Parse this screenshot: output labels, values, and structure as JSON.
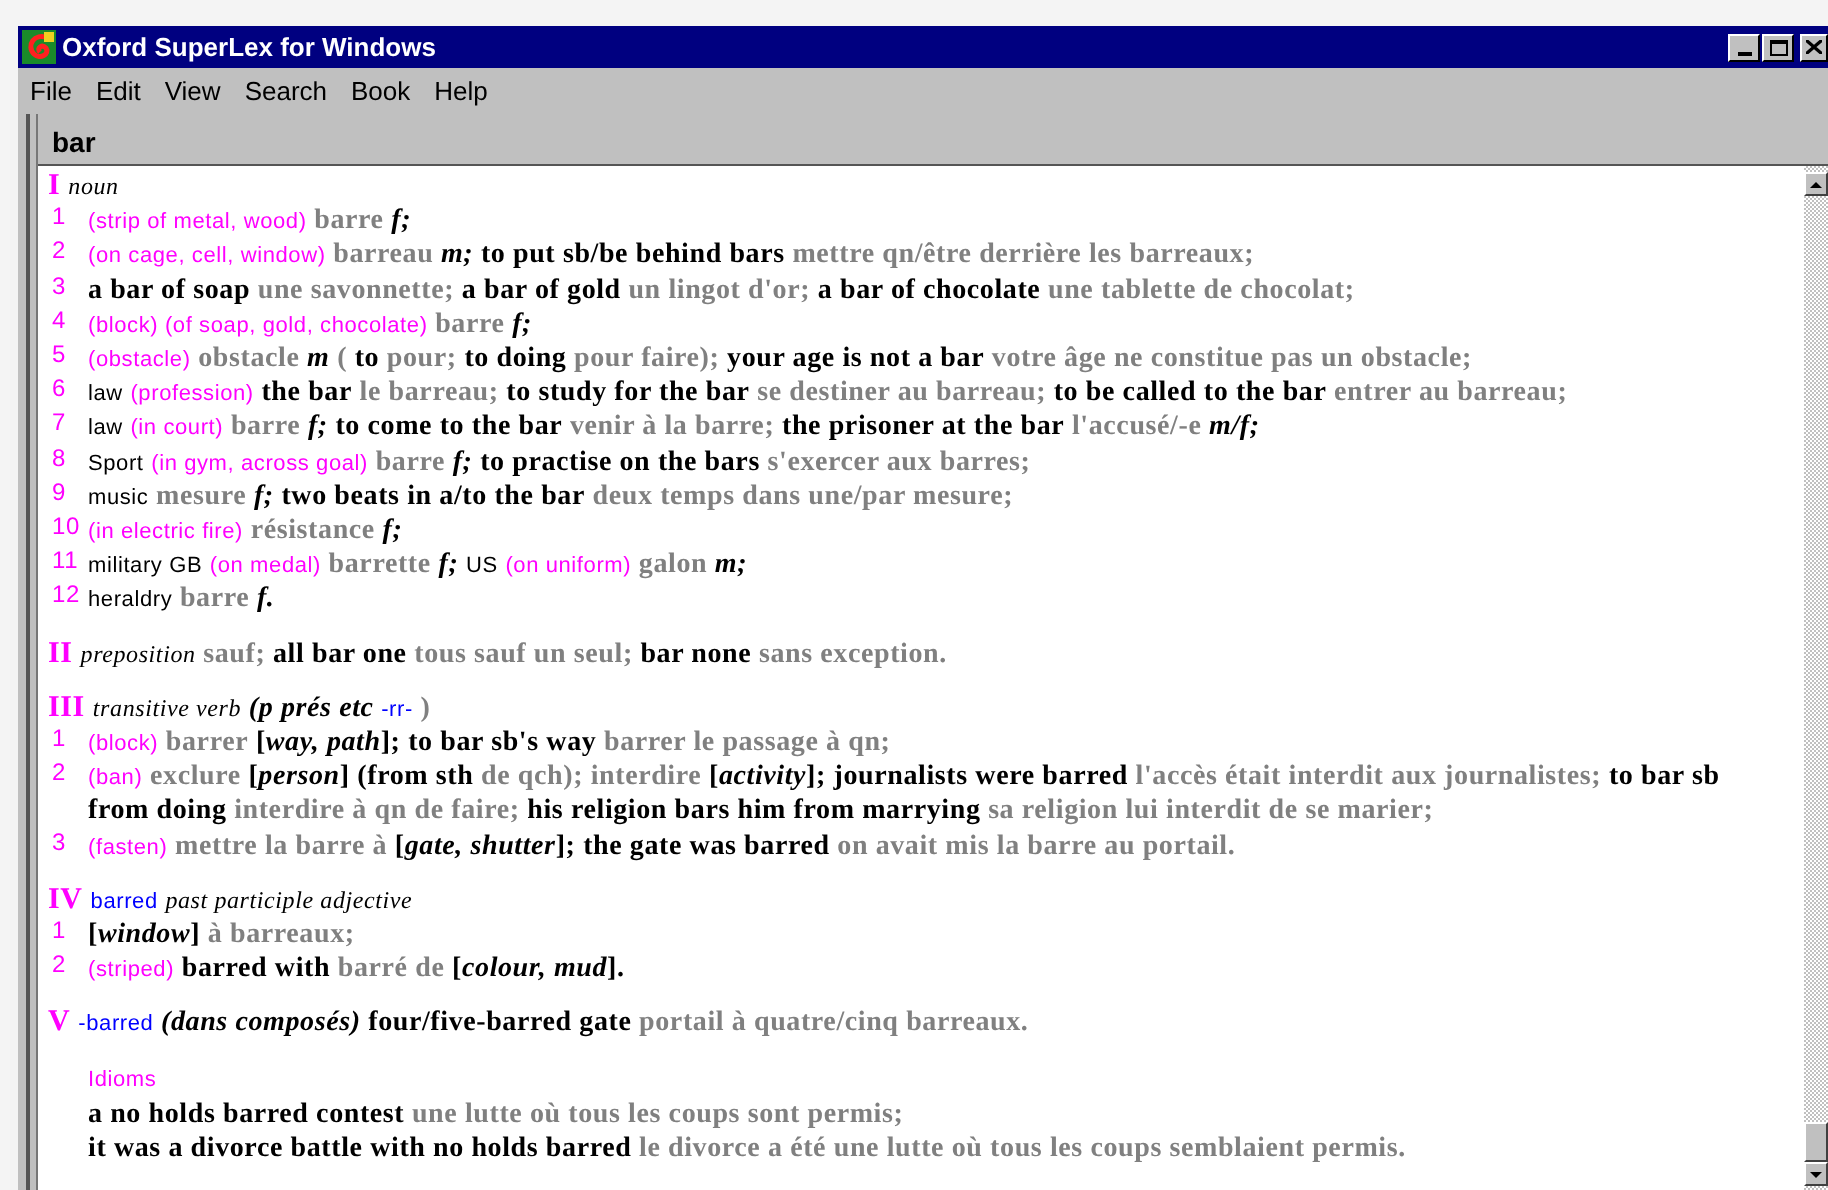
{
  "window": {
    "title": "Oxford SuperLex for Windows"
  },
  "menu": [
    "File",
    "Edit",
    "View",
    "Search",
    "Book",
    "Help"
  ],
  "search": {
    "value": "bar"
  },
  "sections": [
    {
      "numeral": "I",
      "heading": [
        {
          "kind": "pos",
          "text": "noun"
        }
      ],
      "senses": [
        {
          "number": "1",
          "segments": [
            {
              "kind": "label",
              "text": "(strip of metal, wood)"
            },
            {
              "kind": "fr",
              "text": "barre"
            },
            {
              "kind": "gram",
              "text": "f;"
            }
          ]
        },
        {
          "number": "2",
          "segments": [
            {
              "kind": "label",
              "text": "(on cage, cell, window)"
            },
            {
              "kind": "fr",
              "text": "barreau"
            },
            {
              "kind": "gram",
              "text": "m;"
            },
            {
              "kind": "en",
              "text": "to put sb/be behind bars"
            },
            {
              "kind": "fr",
              "text": "mettre qn/être derrière les barreaux;"
            }
          ]
        },
        {
          "number": "3",
          "segments": [
            {
              "kind": "en",
              "text": "a bar of soap"
            },
            {
              "kind": "fr",
              "text": "une savonnette;"
            },
            {
              "kind": "en",
              "text": "a bar of gold"
            },
            {
              "kind": "fr",
              "text": "un lingot d'or;"
            },
            {
              "kind": "en",
              "text": "a bar of chocolate"
            },
            {
              "kind": "fr",
              "text": "une tablette de chocolat;"
            }
          ]
        },
        {
          "number": "4",
          "segments": [
            {
              "kind": "label",
              "text": "(block) (of soap, gold, chocolate)"
            },
            {
              "kind": "fr",
              "text": "barre"
            },
            {
              "kind": "gram",
              "text": "f;"
            }
          ]
        },
        {
          "number": "5",
          "segments": [
            {
              "kind": "label",
              "text": "(obstacle)"
            },
            {
              "kind": "fr",
              "text": "obstacle"
            },
            {
              "kind": "gram",
              "text": "m"
            },
            {
              "kind": "fr",
              "text": "("
            },
            {
              "kind": "en",
              "text": "to"
            },
            {
              "kind": "fr",
              "text": "pour;"
            },
            {
              "kind": "en",
              "text": "to doing"
            },
            {
              "kind": "fr",
              "text": "pour faire);"
            },
            {
              "kind": "en",
              "text": "your age is not a bar"
            },
            {
              "kind": "fr",
              "text": "votre âge ne constitue pas un obstacle;"
            }
          ]
        },
        {
          "number": "6",
          "segments": [
            {
              "kind": "domain",
              "text": "law"
            },
            {
              "kind": "label",
              "text": "(profession)"
            },
            {
              "kind": "en",
              "text": "the bar"
            },
            {
              "kind": "fr",
              "text": "le barreau;"
            },
            {
              "kind": "en",
              "text": "to study for the bar"
            },
            {
              "kind": "fr",
              "text": "se destiner au barreau;"
            },
            {
              "kind": "en",
              "text": "to be called to the bar"
            },
            {
              "kind": "fr",
              "text": "entrer au barreau;"
            }
          ]
        },
        {
          "number": "7",
          "segments": [
            {
              "kind": "domain",
              "text": "law"
            },
            {
              "kind": "label",
              "text": "(in court)"
            },
            {
              "kind": "fr",
              "text": "barre"
            },
            {
              "kind": "gram",
              "text": "f;"
            },
            {
              "kind": "en",
              "text": "to come to the bar"
            },
            {
              "kind": "fr",
              "text": "venir à la barre;"
            },
            {
              "kind": "en",
              "text": "the prisoner at the bar"
            },
            {
              "kind": "fr",
              "text": "l'accusé/-e"
            },
            {
              "kind": "gram",
              "text": "m/f;"
            }
          ]
        },
        {
          "number": "8",
          "segments": [
            {
              "kind": "domain",
              "text": "Sport"
            },
            {
              "kind": "label",
              "text": "(in gym, across goal)"
            },
            {
              "kind": "fr",
              "text": "barre"
            },
            {
              "kind": "gram",
              "text": "f;"
            },
            {
              "kind": "en",
              "text": "to practise on the bars"
            },
            {
              "kind": "fr",
              "text": "s'exercer aux barres;"
            }
          ]
        },
        {
          "number": "9",
          "segments": [
            {
              "kind": "domain",
              "text": "music"
            },
            {
              "kind": "fr",
              "text": "mesure"
            },
            {
              "kind": "gram",
              "text": "f;"
            },
            {
              "kind": "en",
              "text": "two beats in a/to the bar"
            },
            {
              "kind": "fr",
              "text": "deux temps dans une/par mesure;"
            }
          ]
        },
        {
          "number": "10",
          "segments": [
            {
              "kind": "label",
              "text": "(in electric fire)"
            },
            {
              "kind": "fr",
              "text": "résistance"
            },
            {
              "kind": "gram",
              "text": "f;"
            }
          ]
        },
        {
          "number": "11",
          "segments": [
            {
              "kind": "domain",
              "text": "military GB"
            },
            {
              "kind": "label",
              "text": "(on medal)"
            },
            {
              "kind": "fr",
              "text": "barrette"
            },
            {
              "kind": "gram",
              "text": "f;"
            },
            {
              "kind": "domain",
              "text": "US"
            },
            {
              "kind": "label",
              "text": "(on uniform)"
            },
            {
              "kind": "fr",
              "text": "galon"
            },
            {
              "kind": "gram",
              "text": "m;"
            }
          ]
        },
        {
          "number": "12",
          "segments": [
            {
              "kind": "domain",
              "text": "heraldry"
            },
            {
              "kind": "fr",
              "text": "barre"
            },
            {
              "kind": "gram",
              "text": "f."
            }
          ]
        }
      ]
    },
    {
      "numeral": "II",
      "heading": [
        {
          "kind": "pos",
          "text": "preposition"
        },
        {
          "kind": "fr",
          "text": "sauf;"
        },
        {
          "kind": "en",
          "text": "all bar one"
        },
        {
          "kind": "fr",
          "text": "tous sauf un seul;"
        },
        {
          "kind": "en",
          "text": "bar none"
        },
        {
          "kind": "fr",
          "text": "sans exception."
        }
      ]
    },
    {
      "numeral": "III",
      "heading": [
        {
          "kind": "pos",
          "text": "transitive verb"
        },
        {
          "kind": "gram",
          "text": "(p prés etc"
        },
        {
          "kind": "note",
          "text": "-rr-"
        },
        {
          "kind": "fr",
          "text": ")"
        }
      ],
      "senses": [
        {
          "number": "1",
          "segments": [
            {
              "kind": "label",
              "text": "(block)"
            },
            {
              "kind": "fr",
              "text": "barrer"
            },
            {
              "kind": "en",
              "text": "[*way, path*];"
            },
            {
              "kind": "en",
              "text": "to bar sb's way"
            },
            {
              "kind": "fr",
              "text": "barrer le passage à qn;"
            }
          ]
        },
        {
          "number": "2",
          "segments": [
            {
              "kind": "label",
              "text": "(ban)"
            },
            {
              "kind": "fr",
              "text": "exclure"
            },
            {
              "kind": "en",
              "text": "[*person*]"
            },
            {
              "kind": "en",
              "text": "(from sth"
            },
            {
              "kind": "fr",
              "text": "de qch); interdire"
            },
            {
              "kind": "en",
              "text": "[*activity*];"
            },
            {
              "kind": "en",
              "text": "journalists were barred"
            },
            {
              "kind": "fr",
              "text": "l'accès était interdit aux journalistes;"
            },
            {
              "kind": "en",
              "text": "to bar sb from doing"
            },
            {
              "kind": "fr",
              "text": "interdire à qn de faire;"
            },
            {
              "kind": "en",
              "text": "his religion bars him from marrying"
            },
            {
              "kind": "fr",
              "text": "sa religion lui interdit de se marier;"
            }
          ]
        },
        {
          "number": "3",
          "segments": [
            {
              "kind": "label",
              "text": "(fasten)"
            },
            {
              "kind": "fr",
              "text": "mettre la barre à"
            },
            {
              "kind": "en",
              "text": "[*gate, shutter*];"
            },
            {
              "kind": "en",
              "text": "the gate was barred"
            },
            {
              "kind": "fr",
              "text": "on avait mis la barre au portail."
            }
          ]
        }
      ]
    },
    {
      "numeral": "IV",
      "heading": [
        {
          "kind": "note",
          "text": "barred"
        },
        {
          "kind": "pos",
          "text": "past participle adjective"
        }
      ],
      "senses": [
        {
          "number": "1",
          "segments": [
            {
              "kind": "en",
              "text": "[*window*]"
            },
            {
              "kind": "fr",
              "text": "à barreaux;"
            }
          ]
        },
        {
          "number": "2",
          "segments": [
            {
              "kind": "label",
              "text": "(striped)"
            },
            {
              "kind": "en",
              "text": "barred with"
            },
            {
              "kind": "fr",
              "text": "barré de"
            },
            {
              "kind": "en",
              "text": "[*colour, mud*]."
            }
          ]
        }
      ]
    },
    {
      "numeral": "V",
      "heading": [
        {
          "kind": "note",
          "text": "-barred"
        },
        {
          "kind": "gram",
          "text": "(dans composés)"
        },
        {
          "kind": "en",
          "text": "four/five-barred gate"
        },
        {
          "kind": "fr",
          "text": "portail à quatre/cinq barreaux."
        }
      ]
    }
  ],
  "idioms": {
    "label": "Idioms",
    "lines": [
      [
        {
          "kind": "en",
          "text": "a no holds barred contest"
        },
        {
          "kind": "fr",
          "text": "une lutte où tous les coups sont permis;"
        }
      ],
      [
        {
          "kind": "en",
          "text": "it was a divorce battle with no holds barred"
        },
        {
          "kind": "fr",
          "text": "le divorce a été une lutte où tous les coups semblaient permis."
        }
      ]
    ]
  }
}
